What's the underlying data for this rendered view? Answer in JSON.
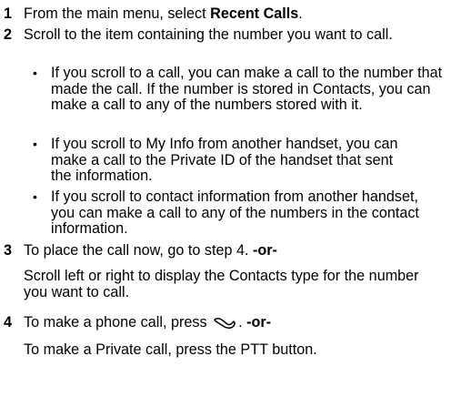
{
  "steps": {
    "s1": {
      "num": "1",
      "pre": "From the main menu, select ",
      "bold": "Recent Calls",
      "post": "."
    },
    "s2": {
      "num": "2",
      "text": "Scroll to the item containing the number you want to call.",
      "bullets": [
        "If you scroll to a call, you can make a call to the number that made the call. If the number is stored in Contacts, you can make a call to any of the numbers stored with it.",
        "If you scroll to My Info from another handset, you can make a call to the Private ID of the handset that sent the information.",
        "If you scroll to contact information from another handset, you can make a call to any of the numbers in the contact information."
      ]
    },
    "s3": {
      "num": "3",
      "text": "To place the call now, go to step 4. ",
      "or": "-or-",
      "sub": "Scroll left or right to display the Contacts type for the number you want to call."
    },
    "s4": {
      "num": "4",
      "pre": "To make a phone call, press ",
      "post": ". ",
      "or": "-or-",
      "sub": "To make a Private call, press the PTT button."
    }
  },
  "icons": {
    "send_key": "phone-send-icon"
  }
}
